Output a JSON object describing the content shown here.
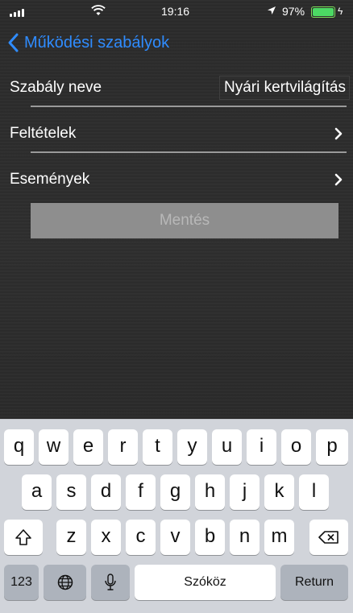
{
  "status_bar": {
    "time": "19:16",
    "battery_percent": "97%",
    "location_icon": "location-arrow-icon",
    "wifi_icon": "wifi-icon",
    "signal_icon": "signal-icon",
    "battery_icon": "battery-charging-icon"
  },
  "nav": {
    "back_label": "Működési szabályok",
    "accent": "#2f8cff"
  },
  "form": {
    "rule_name_label": "Szabály neve",
    "rule_name_value": "Nyári kertvilágítás",
    "conditions_label": "Feltételek",
    "events_label": "Események",
    "save_label": "Mentés"
  },
  "keyboard": {
    "row1": [
      "q",
      "w",
      "e",
      "r",
      "t",
      "y",
      "u",
      "i",
      "o",
      "p"
    ],
    "row2": [
      "a",
      "s",
      "d",
      "f",
      "g",
      "h",
      "j",
      "k",
      "l"
    ],
    "row3": [
      "z",
      "x",
      "c",
      "v",
      "b",
      "n",
      "m"
    ],
    "numbers_label": "123",
    "space_label": "Szóköz",
    "return_label": "Return"
  }
}
